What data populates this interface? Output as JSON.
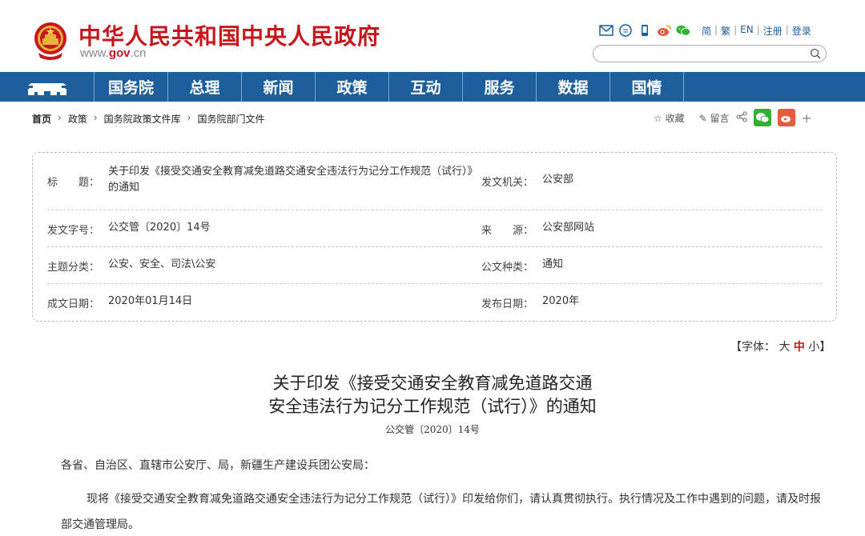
{
  "header": {
    "site_title": "中华人民共和国中央人民政府",
    "domain_prefix": "www.",
    "domain_brand": "gov",
    "domain_suffix": ".cn",
    "links": [
      "简",
      "繁",
      "EN",
      "注册",
      "登录"
    ],
    "search_placeholder": ""
  },
  "nav": {
    "items": [
      "国务院",
      "总理",
      "新闻",
      "政策",
      "互动",
      "服务",
      "数据",
      "国情"
    ]
  },
  "breadcrumb": [
    "首页",
    "政策",
    "国务院政策文件库",
    "国务院部门文件"
  ],
  "actions": {
    "favorite": "收藏",
    "comment": "留言",
    "plus": "+"
  },
  "info": {
    "title_label": "标　　题：",
    "title_value": "关于印发《接受交通安全教育减免道路交通安全违法行为记分工作规范（试行）》的通知",
    "issuer_label": "发文机关：",
    "issuer_value": "公安部",
    "doc_no_label": "发文字号：",
    "doc_no_value": "公交管〔2020〕14号",
    "source_label": "来　　源：",
    "source_value": "公安部网站",
    "topic_label": "主题分类：",
    "topic_value": "公安、安全、司法\\公安",
    "type_label": "公文种类：",
    "type_value": "通知",
    "written_label": "成文日期：",
    "written_value": "2020年01月14日",
    "published_label": "发布日期：",
    "published_value": "2020年"
  },
  "font_selector": {
    "prefix": "【字体：",
    "large": "大",
    "medium": "中",
    "small": "小",
    "suffix": "】"
  },
  "document": {
    "title_line1": "关于印发《接受交通安全教育减免道路交通",
    "title_line2": "安全违法行为记分工作规范（试行）》的通知",
    "number": "公交管〔2020〕14号",
    "salutation": "各省、自治区、直辖市公安厅、局，新疆生产建设兵团公安局：",
    "paragraph1": "现将《接受交通安全教育减免道路交通安全违法行为记分工作规范（试行）》印发给你们，请认真贯彻执行。执行情况及工作中遇到的问题，请及时报部交通管理局。"
  },
  "colors": {
    "brand_red": "#c8161d",
    "nav_blue": "#1d5e9c",
    "wechat_green": "#2fb131",
    "weibo_orange": "#e9593a"
  }
}
